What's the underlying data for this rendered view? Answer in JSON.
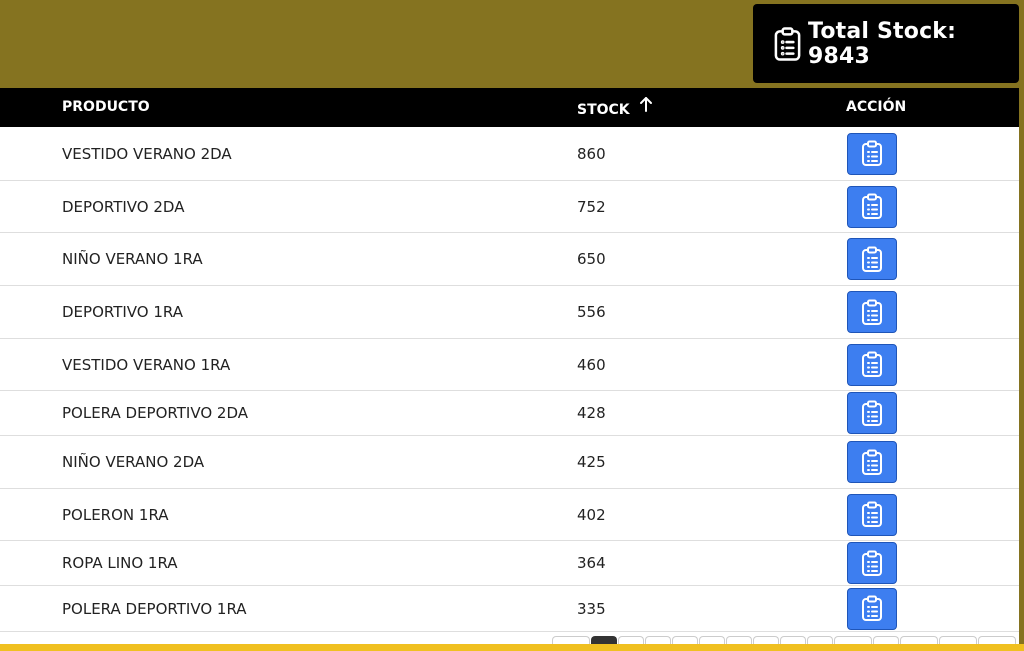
{
  "total": {
    "label": "Total Stock: 9843",
    "icon": "clipboard-list-icon"
  },
  "table": {
    "headers": {
      "producto": "PRODUCTO",
      "stock": "STOCK",
      "accion": "ACCIÓN"
    },
    "sort": {
      "column": "stock",
      "icon": "arrow-up-icon"
    },
    "rows": [
      {
        "producto": "VESTIDO VERANO 2DA",
        "stock": "860"
      },
      {
        "producto": "DEPORTIVO 2DA",
        "stock": "752"
      },
      {
        "producto": "NIÑO VERANO 1RA",
        "stock": "650"
      },
      {
        "producto": "DEPORTIVO 1RA",
        "stock": "556"
      },
      {
        "producto": "VESTIDO VERANO 1RA",
        "stock": "460"
      },
      {
        "producto": "POLERA DEPORTIVO 2DA",
        "stock": "428"
      },
      {
        "producto": "NIÑO VERANO 2DA",
        "stock": "425"
      },
      {
        "producto": "POLERON 1RA",
        "stock": "402"
      },
      {
        "producto": "ROPA LINO 1RA",
        "stock": "364"
      },
      {
        "producto": "POLERA DEPORTIVO 1RA",
        "stock": "335"
      }
    ],
    "action_icon": "clipboard-list-icon"
  },
  "pagination": {
    "active_page_index": 1
  },
  "colors": {
    "header_bg": "#857320",
    "card_bg": "#000000",
    "table_head_bg": "#000000",
    "action_button": "#3d7ef0",
    "bottom_strip": "#f0c020"
  }
}
